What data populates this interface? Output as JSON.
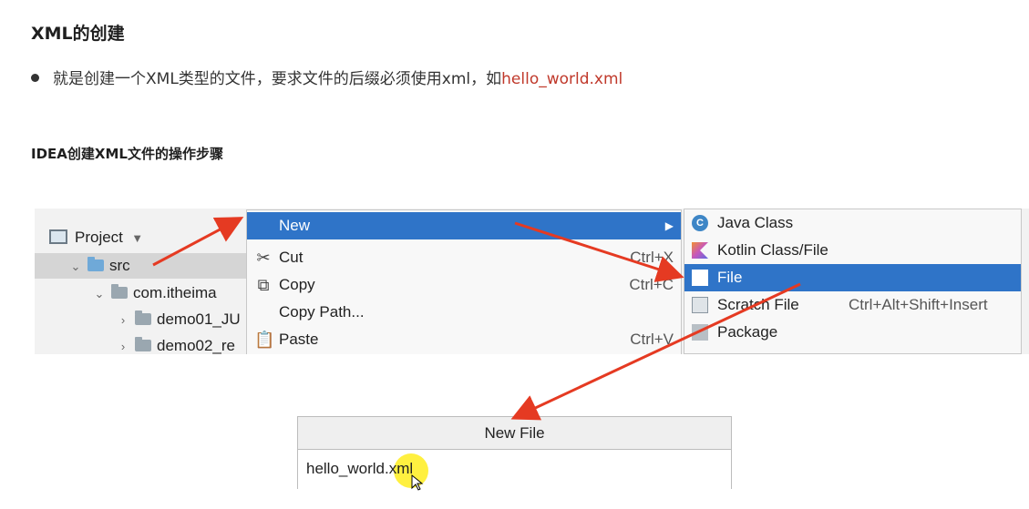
{
  "doc": {
    "title": "XML的创建",
    "bullet_text": "就是创建一个XML类型的文件，要求文件的后缀必须使用xml，如",
    "bullet_highlight": "hello_world.xml",
    "section_title": "IDEA创建XML文件的操作步骤"
  },
  "project_tree": {
    "header": "Project",
    "items": [
      {
        "label": "src"
      },
      {
        "label": "com.itheima"
      },
      {
        "label": "demo01_JU"
      },
      {
        "label": "demo02_re"
      }
    ]
  },
  "context_menu": {
    "items": [
      {
        "label": "New",
        "shortcut": "",
        "icon": "none"
      },
      {
        "label": "Cut",
        "shortcut": "Ctrl+X",
        "icon": "scissors-icon"
      },
      {
        "label": "Copy",
        "shortcut": "Ctrl+C",
        "icon": "copy-icon"
      },
      {
        "label": "Copy Path...",
        "shortcut": "",
        "icon": "none"
      },
      {
        "label": "Paste",
        "shortcut": "Ctrl+V",
        "icon": "paste-icon"
      }
    ]
  },
  "new_submenu": {
    "items": [
      {
        "label": "Java Class",
        "shortcut": "",
        "icon": "java-class-icon"
      },
      {
        "label": "Kotlin Class/File",
        "shortcut": "",
        "icon": "kotlin-icon"
      },
      {
        "label": "File",
        "shortcut": "",
        "icon": "file-icon"
      },
      {
        "label": "Scratch File",
        "shortcut": "Ctrl+Alt+Shift+Insert",
        "icon": "scratch-file-icon"
      },
      {
        "label": "Package",
        "shortcut": "",
        "icon": "package-icon"
      }
    ]
  },
  "dialog": {
    "title": "New File",
    "value": "hello_world.xml"
  },
  "colors": {
    "menu_highlight": "#2f74c8",
    "highlight_text": "#c0392b",
    "arrow": "#e53a22"
  }
}
